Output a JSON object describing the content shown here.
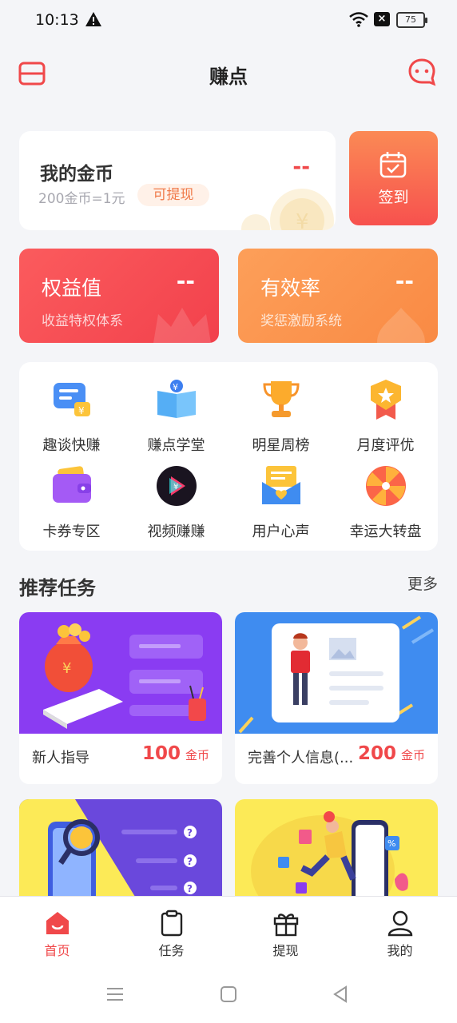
{
  "status": {
    "time": "10:13",
    "battery": "75"
  },
  "header": {
    "title": "赚点"
  },
  "coin": {
    "title": "我的金币",
    "rate": "200金币=1元",
    "withdraw_tag": "可提现",
    "value": "--"
  },
  "signin": {
    "label": "签到"
  },
  "stats": [
    {
      "title": "权益值",
      "subtitle": "收益特权体系",
      "value": "--"
    },
    {
      "title": "有效率",
      "subtitle": "奖惩激励系统",
      "value": "--"
    }
  ],
  "features": [
    {
      "label": "趣谈快赚",
      "icon": "chat-bubble-coin-icon"
    },
    {
      "label": "赚点学堂",
      "icon": "book-coin-icon"
    },
    {
      "label": "明星周榜",
      "icon": "trophy-icon"
    },
    {
      "label": "月度评优",
      "icon": "medal-icon"
    },
    {
      "label": "卡券专区",
      "icon": "wallet-icon"
    },
    {
      "label": "视频赚赚",
      "icon": "video-play-icon"
    },
    {
      "label": "用户心声",
      "icon": "heart-envelope-icon"
    },
    {
      "label": "幸运大转盘",
      "icon": "lucky-wheel-icon"
    }
  ],
  "section": {
    "title": "推荐任务",
    "more": "更多"
  },
  "tasks": [
    {
      "name": "新人指导",
      "reward": "100",
      "unit": "金币"
    },
    {
      "name": "完善个人信息(...",
      "reward": "200",
      "unit": "金币"
    }
  ],
  "nav": [
    {
      "label": "首页",
      "icon": "home-icon",
      "active": true
    },
    {
      "label": "任务",
      "icon": "clipboard-icon"
    },
    {
      "label": "提现",
      "icon": "gift-icon"
    },
    {
      "label": "我的",
      "icon": "user-icon"
    }
  ],
  "colors": {
    "accent": "#f0484a",
    "orange": "#fb8a55",
    "purple": "#8a3cf2",
    "blue": "#3f8cf0",
    "yellow": "#fcea57"
  }
}
